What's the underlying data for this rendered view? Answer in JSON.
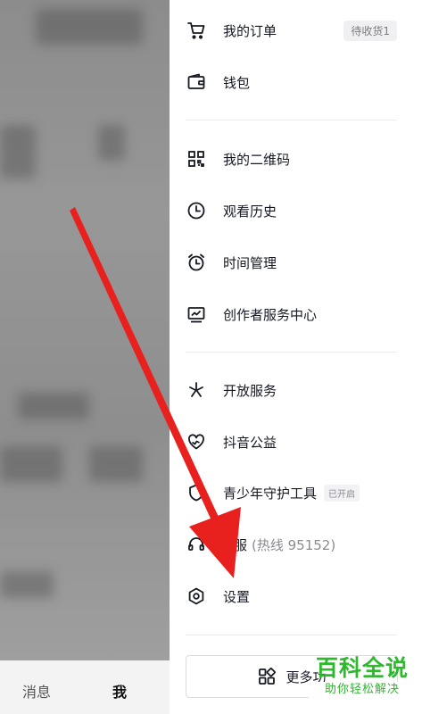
{
  "background_app": {
    "tabs": [
      "消息",
      "我"
    ]
  },
  "drawer": {
    "items": [
      {
        "label": "我的订单",
        "icon": "cart-icon",
        "badge": "待收货1"
      },
      {
        "label": "钱包",
        "icon": "wallet-icon"
      },
      {
        "label": "我的二维码",
        "icon": "qr-code-icon"
      },
      {
        "label": "观看历史",
        "icon": "clock-icon"
      },
      {
        "label": "时间管理",
        "icon": "alarm-clock-icon"
      },
      {
        "label": "创作者服务中心",
        "icon": "creator-chart-icon"
      },
      {
        "label": "开放服务",
        "icon": "open-service-icon"
      },
      {
        "label": "抖音公益",
        "icon": "heart-charity-icon"
      },
      {
        "label": "青少年守护工具",
        "icon": "youth-guard-icon",
        "small_badge": "已开启"
      },
      {
        "label": "服",
        "sub": "(热线 95152)",
        "icon": "headset-icon"
      },
      {
        "label": "设置",
        "icon": "settings-hexagon-icon"
      }
    ],
    "more_button": {
      "label": "更多功",
      "icon": "grid-icon"
    }
  },
  "overlay": {
    "arrow_color": "#e8211f"
  },
  "watermark": {
    "title": "百科全说",
    "subtitle": "助你轻松解决"
  }
}
